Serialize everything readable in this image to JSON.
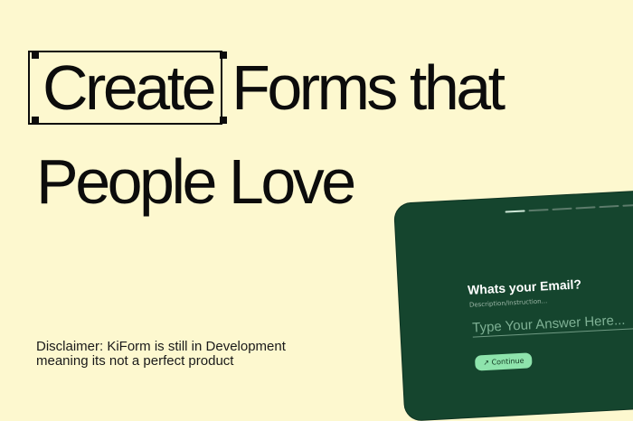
{
  "hero": {
    "word_selected": "Create",
    "line1_rest": "Forms that",
    "line2": "People Love"
  },
  "disclaimer": {
    "line1": "Disclaimer: KiForm is still in Development",
    "line2": "meaning its not a perfect product"
  },
  "form_preview": {
    "progress_steps": 6,
    "active_step": 1,
    "question": "Whats your Email?",
    "description": "Description/Instruction...",
    "answer_placeholder": "Type Your Answer Here...",
    "continue_icon": "arrow-up-right-icon",
    "continue_label": "Continue"
  },
  "colors": {
    "background": "#fdf8cf",
    "text": "#0c0c0c",
    "device": "#15452e",
    "accent": "#8ee3ac"
  }
}
